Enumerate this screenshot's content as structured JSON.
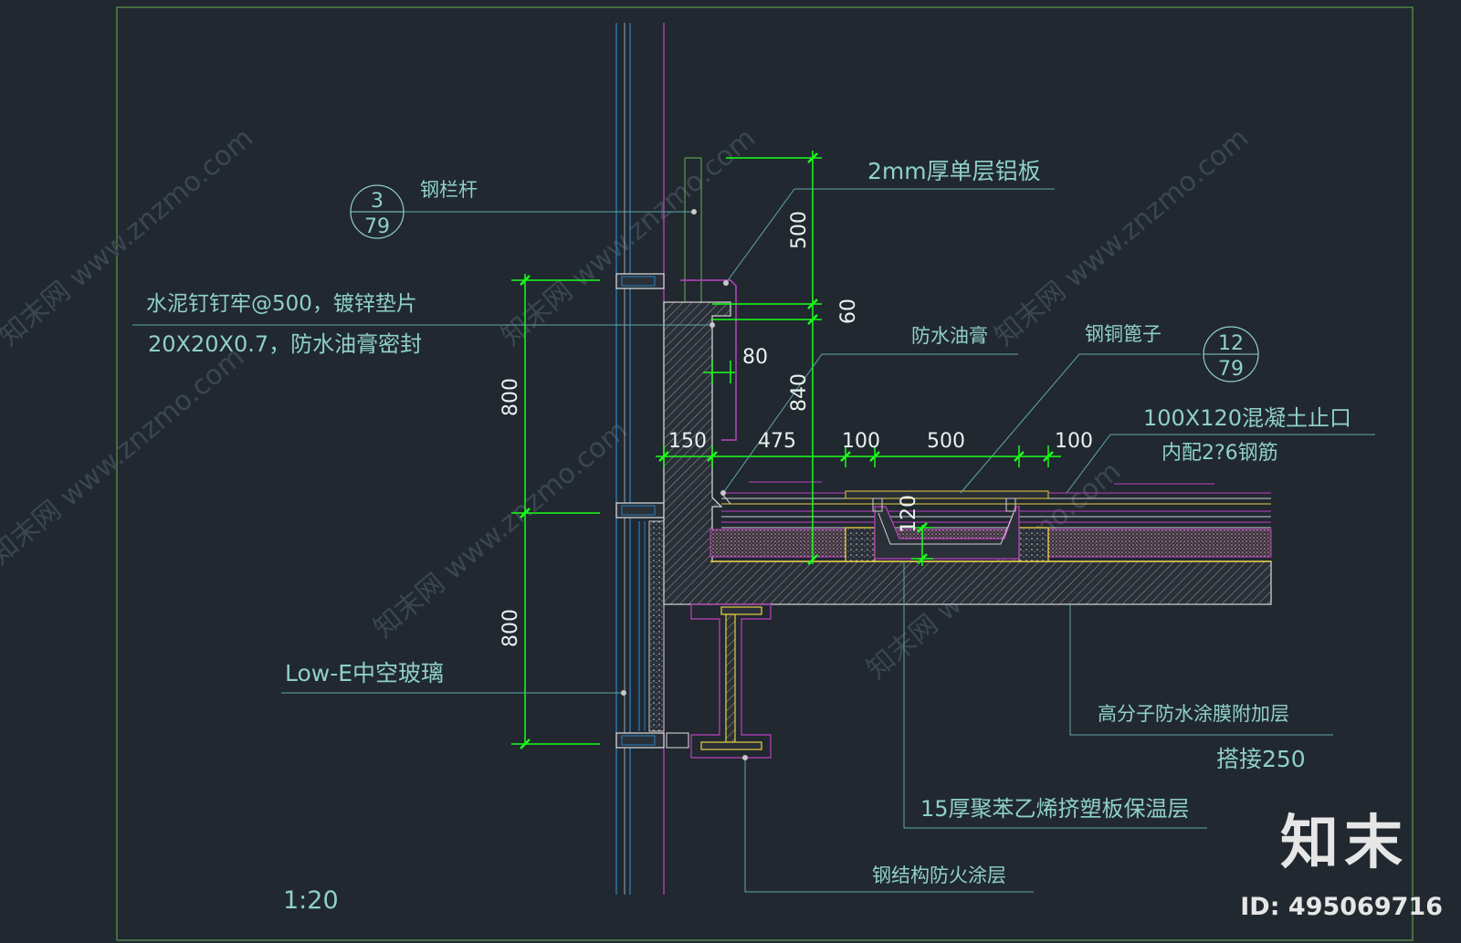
{
  "labels": {
    "railing": "钢栏杆",
    "aluminum": "2mm厚单层铝板",
    "nail_line1": "水泥钉钉牢@500，镀锌垫片",
    "nail_line2": "20X20X0.7，防水油膏密封",
    "sealant": "防水油膏",
    "grate": "钢铜篦子",
    "curb_line1": "100X120混凝土止口",
    "curb_line2": "内配2?6钢筋",
    "glass": "Low-E中空玻璃",
    "membrane": "高分子防水涂膜附加层",
    "overlap": "搭接250",
    "insulation": "15厚聚苯乙烯挤塑板保温层",
    "fireproof": "钢结构防火涂层",
    "scale": "1:20"
  },
  "detail_refs": [
    {
      "top": "3",
      "bottom": "79"
    },
    {
      "top": "12",
      "bottom": "79"
    }
  ],
  "dimensions": {
    "d500": "500",
    "d60": "60",
    "d80": "80",
    "d840": "840",
    "d800a": "800",
    "d800b": "800",
    "d150": "150",
    "d475": "475",
    "d100a": "100",
    "d500b": "500",
    "d100b": "100",
    "d120": "120"
  },
  "watermark": "知末网 www.znzmo.com",
  "brand": {
    "logo": "知末",
    "id": "ID: 495069716"
  },
  "colors": {
    "background": "#212830",
    "frame": "#5e9a50",
    "dimension": "#19ff19",
    "label": "#8fd0c8",
    "magenta": "#c040c0",
    "blue": "#2a7fc0",
    "yellow": "#e8d040",
    "concrete": "#c8c8c8"
  }
}
